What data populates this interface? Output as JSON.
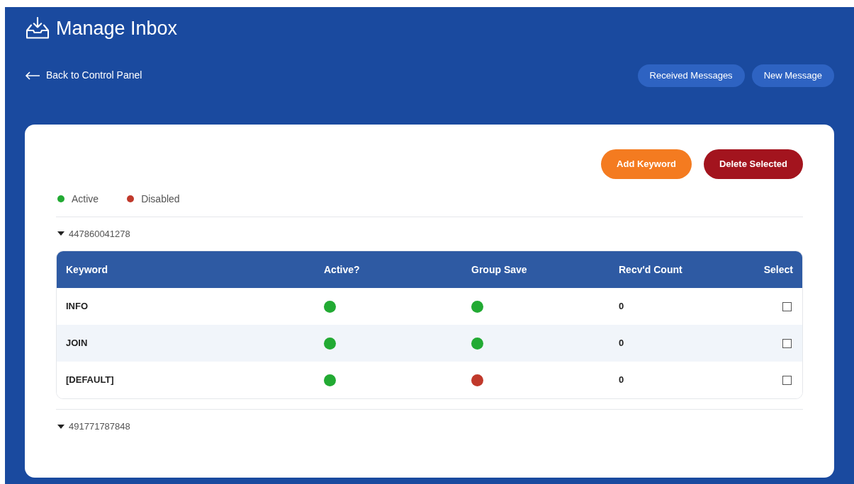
{
  "header": {
    "title": "Manage Inbox",
    "back_link": "Back to Control Panel",
    "buttons": [
      "Received Messages",
      "New Message"
    ]
  },
  "actions": [
    {
      "label": "Add Keyword",
      "kind": "primary"
    },
    {
      "label": "Delete Selected",
      "kind": "danger"
    }
  ],
  "legend": [
    {
      "label": "Active",
      "color": "#22aa33"
    },
    {
      "label": "Disabled",
      "color": "#c0392b"
    }
  ],
  "groups": [
    {
      "number": "447860041278",
      "table": {
        "columns": [
          "Keyword",
          "Active?",
          "Group Save",
          "Recv'd Count",
          "Select"
        ],
        "rows": [
          {
            "keyword": "INFO",
            "active": true,
            "group_save": true,
            "count": "0",
            "checked": false
          },
          {
            "keyword": "JOIN",
            "active": true,
            "group_save": true,
            "count": "0",
            "checked": false
          },
          {
            "keyword": "[DEFAULT]",
            "active": true,
            "group_save": false,
            "count": "0",
            "checked": false
          }
        ]
      }
    },
    {
      "number": "491771787848"
    }
  ]
}
